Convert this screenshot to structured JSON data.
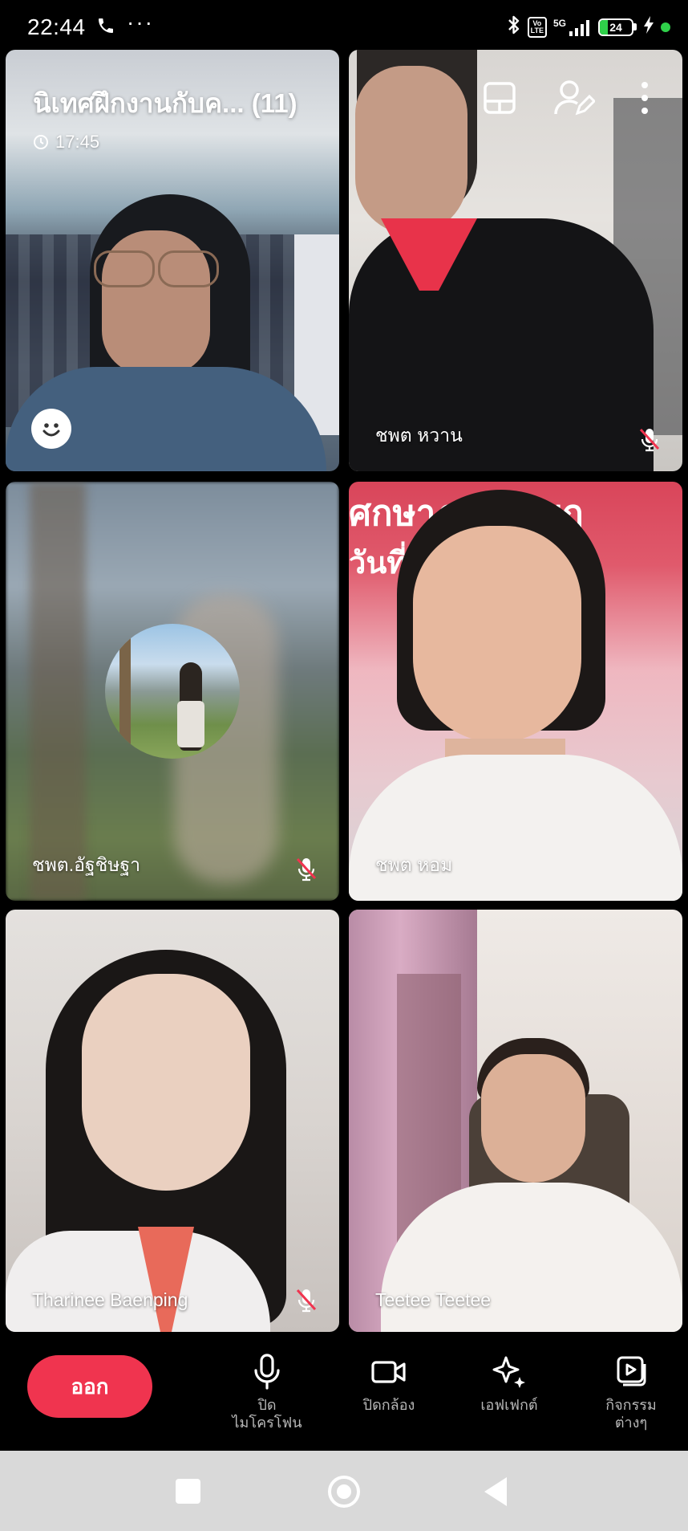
{
  "status_bar": {
    "time": "22:44",
    "dots": "···",
    "volte_line1": "Vo",
    "volte_line2": "LTE",
    "network": "5G",
    "battery": "24",
    "battery_level": 0.24,
    "charging_dot_color": "#2fd14a"
  },
  "meeting": {
    "title": "นิเทศฝึกงานกับค... (11)",
    "duration": "17:45"
  },
  "participants": [
    {
      "name": "",
      "muted": false
    },
    {
      "name": "ชพต  หวาน",
      "muted": true
    },
    {
      "name": "ชพต.อัฐชิษฐา",
      "muted": true
    },
    {
      "name": "ชพต หอม",
      "muted": false
    },
    {
      "name": "Tharinee Baenping",
      "muted": true
    },
    {
      "name": "Teetee Teetee",
      "muted": false
    }
  ],
  "tile4_background_text": {
    "line1": "ศกษาฎกร 2 พฤ",
    "line2": "วันที่      ม 256"
  },
  "controls": {
    "leave": "ออก",
    "mic_line1": "ปิด",
    "mic_line2": "ไมโครโฟน",
    "camera": "ปิดกล้อง",
    "effects": "เอฟเฟกต์",
    "activities_line1": "กิจกรรม",
    "activities_line2": "ต่างๆ"
  },
  "colors": {
    "leave_button": "#f0344f",
    "mute_icon": "#f0344f"
  }
}
